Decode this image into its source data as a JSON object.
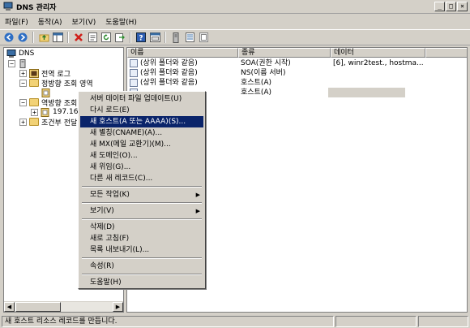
{
  "window": {
    "title": "DNS 관리자",
    "controls": [
      "_",
      "□",
      "×"
    ]
  },
  "menubar": [
    "파일(F)",
    "동작(A)",
    "보기(V)",
    "도움말(H)"
  ],
  "tree": {
    "root": "DNS",
    "items": [
      "전역 로그",
      "정방향 조회 영역",
      "",
      "역방향 조회",
      "197.161",
      "조건부 전달"
    ]
  },
  "list": {
    "columns": [
      "이름",
      "종류",
      "데이터"
    ],
    "rows": [
      {
        "name": "(상위 폴더와 같음)",
        "type": "SOA(권한 시작)",
        "data": "[6], winr2test., hostma..."
      },
      {
        "name": "(상위 폴더와 같음)",
        "type": "NS(이름 서버)",
        "data": ""
      },
      {
        "name": "(상위 폴더와 같음)",
        "type": "호스트(A)",
        "data": ""
      },
      {
        "name": "",
        "type": "호스트(A)",
        "data": ""
      }
    ]
  },
  "context_menu": {
    "items": [
      "서버 데이터 파일 업데이트(U)",
      "다시 로드(E)",
      "새 호스트(A 또는 AAAA)(S)...",
      "새 별칭(CNAME)(A)...",
      "새 MX(메일 교환기)(M)...",
      "새 도메인(O)...",
      "새 위임(G)...",
      "다른 새 레코드(C)...",
      "모든 작업(K)",
      "보기(V)",
      "삭제(D)",
      "새로 고침(F)",
      "목록 내보내기(L)...",
      "속성(R)",
      "도움말(H)"
    ],
    "selected": "새 호스트(A 또는 AAAA)(S)...",
    "submenu_arrow": "▶"
  },
  "status": {
    "text": "새 호스트 리소스 레코드를 만듭니다."
  },
  "colors": {
    "selection": "#0a246a",
    "face": "#d4d0c8"
  },
  "icons": [
    "dns-icon",
    "back-icon",
    "forward-icon",
    "up-folder-icon",
    "console-tree-icon",
    "delete-icon",
    "properties-icon",
    "refresh-icon",
    "export-icon",
    "help-icon",
    "view-icon",
    "server-icon",
    "list-icon",
    "zone-icon"
  ]
}
